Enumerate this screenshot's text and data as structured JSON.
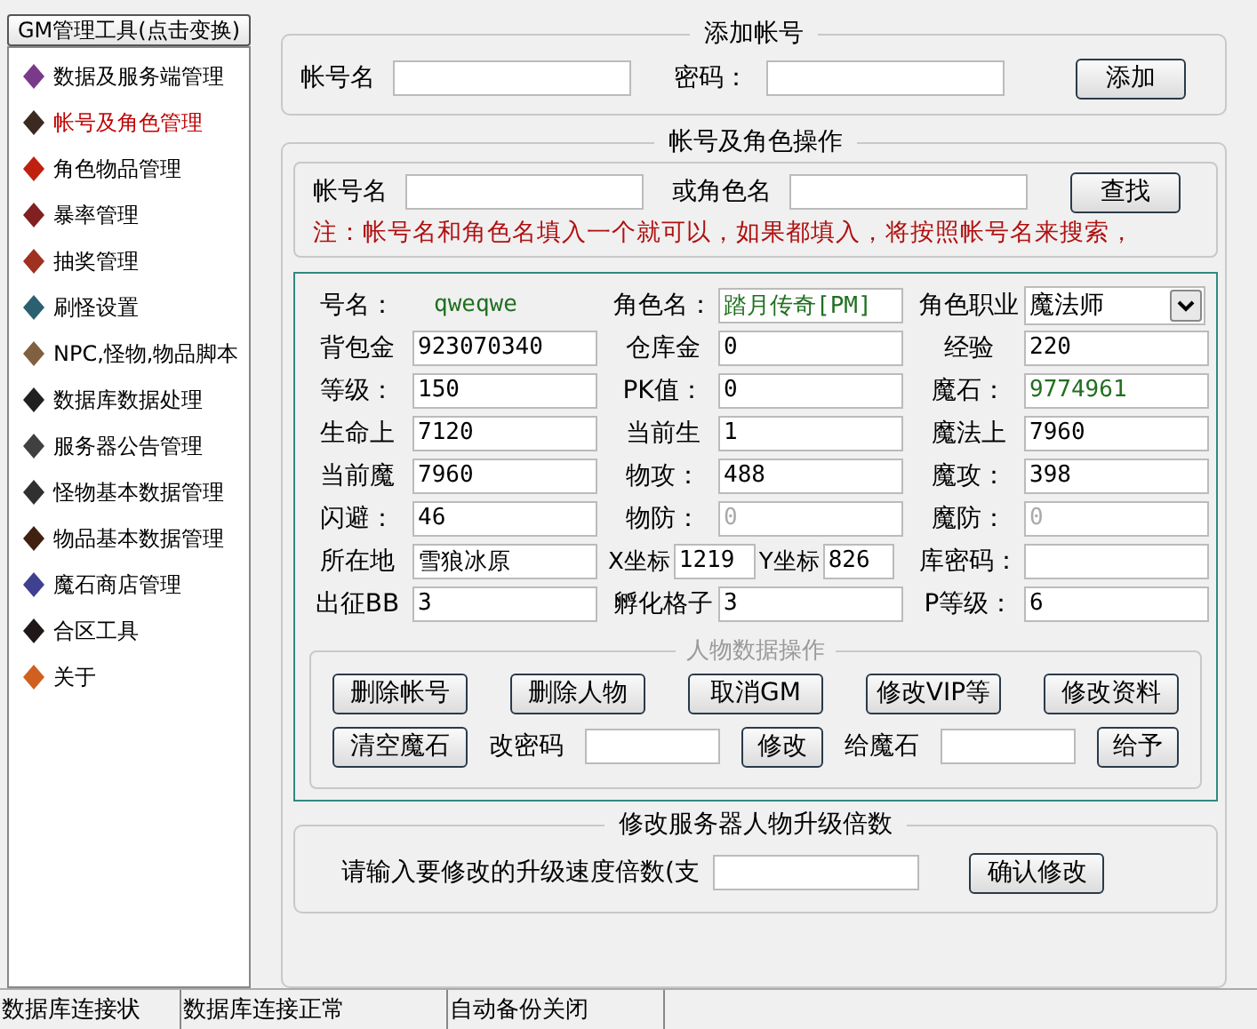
{
  "sidebar": {
    "header": "GM管理工具(点击变换)",
    "items": [
      {
        "label": "数据及服务端管理",
        "selected": false
      },
      {
        "label": "帐号及角色管理",
        "selected": true
      },
      {
        "label": "角色物品管理",
        "selected": false
      },
      {
        "label": "暴率管理",
        "selected": false
      },
      {
        "label": "抽奖管理",
        "selected": false
      },
      {
        "label": "刷怪设置",
        "selected": false
      },
      {
        "label": "NPC,怪物,物品脚本",
        "selected": false
      },
      {
        "label": "数据库数据处理",
        "selected": false
      },
      {
        "label": "服务器公告管理",
        "selected": false
      },
      {
        "label": "怪物基本数据管理",
        "selected": false
      },
      {
        "label": "物品基本数据管理",
        "selected": false
      },
      {
        "label": "魔石商店管理",
        "selected": false
      },
      {
        "label": "合区工具",
        "selected": false
      },
      {
        "label": "关于",
        "selected": false
      }
    ]
  },
  "add_account": {
    "title": "添加帐号",
    "account_label": "帐号名",
    "password_label": "密码：",
    "button": "添加"
  },
  "account_ops": {
    "title": "帐号及角色操作",
    "search": {
      "account_label": "帐号名",
      "role_label": "或角色名",
      "button": "查找",
      "note": "注：帐号名和角色名填入一个就可以，如果都填入，将按照帐号名来搜索，"
    },
    "fields": [
      [
        {
          "kind": "text",
          "label": "号名：",
          "value": "qweqwe",
          "highlight": true
        },
        {
          "kind": "input",
          "label": "角色名：",
          "value": "踏月传奇[PM]",
          "highlight": true,
          "disabled": false
        },
        {
          "kind": "select",
          "label": "角色职业",
          "value": "魔法师"
        }
      ],
      [
        {
          "kind": "input",
          "label": "背包金",
          "value": "923070340",
          "highlight": false,
          "disabled": false
        },
        {
          "kind": "input",
          "label": "仓库金",
          "value": "0",
          "highlight": false,
          "disabled": false
        },
        {
          "kind": "input",
          "label": "经验",
          "value": "220",
          "highlight": false,
          "disabled": false
        }
      ],
      [
        {
          "kind": "input",
          "label": "等级：",
          "value": "150",
          "highlight": false,
          "disabled": false
        },
        {
          "kind": "input",
          "label": "PK值：",
          "value": "0",
          "highlight": false,
          "disabled": false
        },
        {
          "kind": "input",
          "label": "魔石：",
          "value": "9774961",
          "highlight": true,
          "disabled": false
        }
      ],
      [
        {
          "kind": "input",
          "label": "生命上",
          "value": "7120",
          "highlight": false,
          "disabled": false
        },
        {
          "kind": "input",
          "label": "当前生",
          "value": "1",
          "highlight": false,
          "disabled": false
        },
        {
          "kind": "input",
          "label": "魔法上",
          "value": "7960",
          "highlight": false,
          "disabled": false
        }
      ],
      [
        {
          "kind": "input",
          "label": "当前魔",
          "value": "7960",
          "highlight": false,
          "disabled": false
        },
        {
          "kind": "input",
          "label": "物攻：",
          "value": "488",
          "highlight": false,
          "disabled": false
        },
        {
          "kind": "input",
          "label": "魔攻：",
          "value": "398",
          "highlight": false,
          "disabled": false
        }
      ],
      [
        {
          "kind": "input",
          "label": "闪避：",
          "value": "46",
          "highlight": false,
          "disabled": false
        },
        {
          "kind": "input",
          "label": "物防：",
          "value": "0",
          "highlight": false,
          "disabled": true
        },
        {
          "kind": "input",
          "label": "魔防：",
          "value": "0",
          "highlight": false,
          "disabled": true
        }
      ],
      [
        {
          "kind": "input",
          "label": "所在地",
          "value": "雪狼冰原",
          "highlight": false,
          "disabled": false
        },
        {
          "kind": "coords",
          "x_label": "X坐标",
          "x_value": "1219",
          "y_label": "Y坐标",
          "y_value": "826"
        },
        {
          "kind": "input",
          "label": "库密码："
        }
      ],
      [
        {
          "kind": "input",
          "label": "出征BB",
          "value": "3",
          "highlight": false,
          "disabled": false
        },
        {
          "kind": "input",
          "label": "孵化格子",
          "value": "3",
          "highlight": false,
          "disabled": false
        },
        {
          "kind": "input",
          "label": "P等级：",
          "value": "6",
          "highlight": false,
          "disabled": false
        }
      ]
    ],
    "actions": {
      "title": "人物数据操作",
      "buttons": [
        "删除帐号",
        "删除人物",
        "取消GM",
        "修改VIP等",
        "修改资料"
      ],
      "clear_button": "清空魔石",
      "password_label": "改密码",
      "password_button": "修改",
      "gem_label": "给魔石",
      "gem_button": "给予"
    },
    "rate": {
      "title": "修改服务器人物升级倍数",
      "prompt": "请输入要修改的升级速度倍数(支",
      "button": "确认修改"
    }
  },
  "status_bar": [
    "数据库连接状",
    "数据库连接正常",
    "自动备份关闭"
  ]
}
